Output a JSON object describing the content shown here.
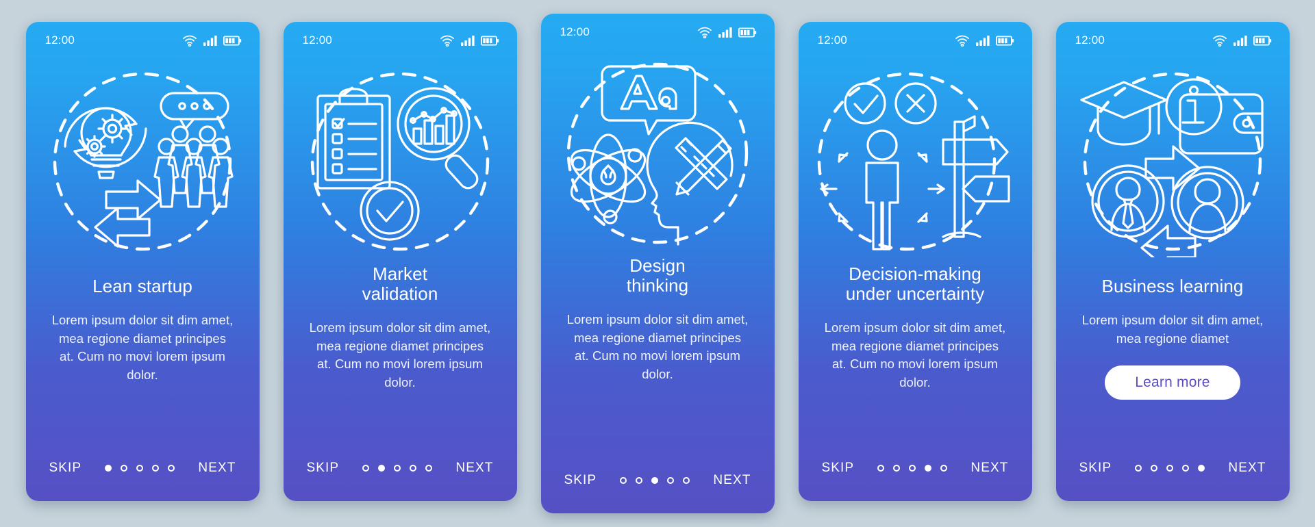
{
  "background_color": "#c6d3db",
  "card_gradient": {
    "top": "#25abf2",
    "bottom": "#5650c4"
  },
  "cta_text_color": "#5a4fbd",
  "common": {
    "clock": "12:00",
    "skip_label": "SKIP",
    "next_label": "NEXT",
    "total_dots": 5,
    "status_icons": [
      "wifi-icon",
      "signal-icon",
      "battery-icon"
    ]
  },
  "screens": [
    {
      "id": "lean-startup",
      "clock": "12:00",
      "title_lines": [
        "Lean startup"
      ],
      "body": "Lorem ipsum dolor sit dim amet, mea regione diamet principes at. Cum no movi lorem ipsum dolor.",
      "skip_label": "SKIP",
      "next_label": "NEXT",
      "active_dot": 1,
      "illustration": "lightbulb-gears-team-icon",
      "cta_label": null
    },
    {
      "id": "market-validation",
      "clock": "12:00",
      "title_lines": [
        "Market",
        "validation"
      ],
      "body": "Lorem ipsum dolor sit dim amet, mea regione diamet principes at. Cum no movi lorem ipsum dolor.",
      "skip_label": "SKIP",
      "next_label": "NEXT",
      "active_dot": 2,
      "illustration": "clipboard-magnifier-check-icon",
      "cta_label": null
    },
    {
      "id": "design-thinking",
      "clock": "12:00",
      "title_lines": [
        "Design",
        "thinking"
      ],
      "body": "Lorem ipsum dolor sit dim amet, mea regione diamet principes at. Cum no movi lorem ipsum dolor.",
      "skip_label": "SKIP",
      "next_label": "NEXT",
      "active_dot": 3,
      "illustration": "typography-atom-head-icon",
      "cta_label": null
    },
    {
      "id": "decision-making",
      "clock": "12:00",
      "title_lines": [
        "Decision-making",
        "under uncertainty"
      ],
      "body": "Lorem ipsum dolor sit dim amet, mea regione diamet principes at. Cum no movi lorem ipsum dolor.",
      "skip_label": "SKIP",
      "next_label": "NEXT",
      "active_dot": 4,
      "illustration": "person-signpost-choice-icon",
      "cta_label": null
    },
    {
      "id": "business-learning",
      "clock": "12:00",
      "title_lines": [
        "Business learning"
      ],
      "body": "Lorem ipsum dolor sit dim amet, mea regione diamet",
      "skip_label": "SKIP",
      "next_label": "NEXT",
      "active_dot": 5,
      "illustration": "graduation-wallet-people-icon",
      "cta_label": "Learn more"
    }
  ]
}
